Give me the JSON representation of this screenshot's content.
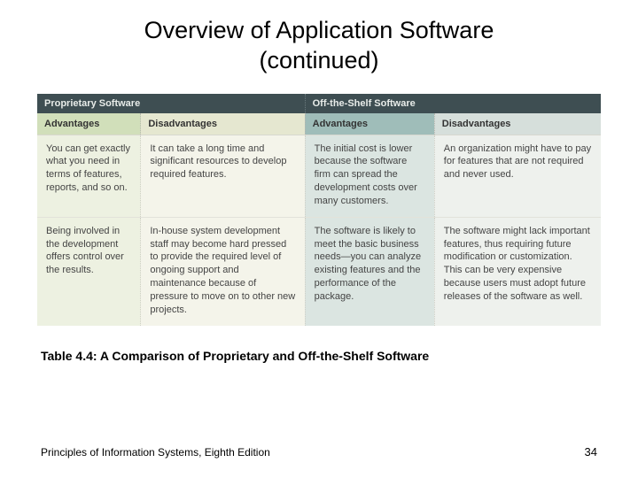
{
  "title_line1": "Overview of Application Software",
  "title_line2": "(continued)",
  "table": {
    "top_headers": [
      "Proprietary Software",
      "Off-the-Shelf Software"
    ],
    "sub_headers": [
      "Advantages",
      "Disadvantages",
      "Advantages",
      "Disadvantages"
    ],
    "rows": [
      [
        "You can get exactly what you need in terms of features, reports, and so on.",
        "It can take a long time and significant resources to develop required features.",
        "The initial cost is lower because the software firm can spread the development costs over many customers.",
        "An organization might have to pay for features that are not required and never used."
      ],
      [
        "Being involved in the development offers control over the results.",
        "In-house system development staff may become hard pressed to provide the required level of ongoing support and maintenance because of pressure to move on to other new projects.",
        "The software is likely to meet the basic business needs—you can analyze existing features and the performance of the package.",
        "The software might lack important features, thus requiring future modification or customization. This can be very expensive because users must adopt future releases of the software as well."
      ]
    ]
  },
  "caption": "Table 4.4: A Comparison of Proprietary and Off-the-Shelf Software",
  "footer_left": "Principles of Information Systems, Eighth Edition",
  "footer_right": "34"
}
